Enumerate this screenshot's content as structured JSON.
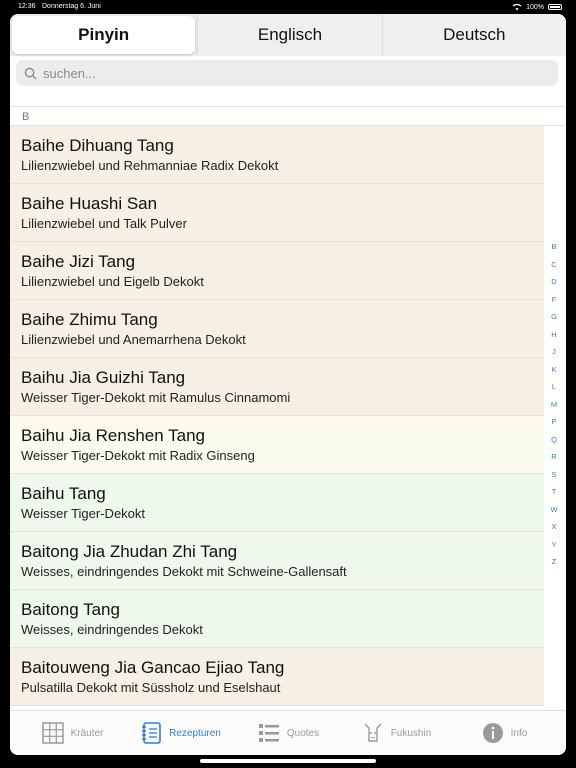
{
  "status": {
    "time": "12:36",
    "date": "Donnerstag 6. Juni",
    "battery": "100%"
  },
  "segments": [
    {
      "label": "Pinyin",
      "active": true
    },
    {
      "label": "Englisch",
      "active": false
    },
    {
      "label": "Deutsch",
      "active": false
    }
  ],
  "search": {
    "placeholder": "suchen..."
  },
  "section": "B",
  "rows": [
    {
      "title": "Baihe Dihuang Tang",
      "subtitle": "Lilienzwiebel und Rehmanniae Radix Dekokt",
      "tint": "beige"
    },
    {
      "title": "Baihe Huashi San",
      "subtitle": "Lilienzwiebel und Talk Pulver",
      "tint": "beige"
    },
    {
      "title": "Baihe Jizi Tang",
      "subtitle": "Lilienzwiebel und Eigelb Dekokt",
      "tint": "beige"
    },
    {
      "title": "Baihe Zhimu Tang",
      "subtitle": "Lilienzwiebel und Anemarrhena Dekokt",
      "tint": "beige"
    },
    {
      "title": "Baihu Jia Guizhi Tang",
      "subtitle": "Weisser Tiger-Dekokt mit Ramulus Cinnamomi",
      "tint": "beige"
    },
    {
      "title": "Baihu Jia Renshen Tang",
      "subtitle": "Weisser Tiger-Dekokt mit Radix Ginseng",
      "tint": "lightyellow"
    },
    {
      "title": "Baihu Tang",
      "subtitle": "Weisser Tiger-Dekokt",
      "tint": "lightgreen"
    },
    {
      "title": "Baitong Jia Zhudan Zhi Tang",
      "subtitle": "Weisses, eindringendes Dekokt mit Schweine-Gallensaft",
      "tint": "lightgreen"
    },
    {
      "title": "Baitong Tang",
      "subtitle": "Weisses, eindringendes Dekokt",
      "tint": "lightgreen"
    },
    {
      "title": "Baitouweng Jia Gancao Ejiao Tang",
      "subtitle": "Pulsatilla Dekokt mit Süssholz und Eselshaut",
      "tint": "beige"
    }
  ],
  "index_letters": [
    "B",
    "C",
    "D",
    "F",
    "G",
    "H",
    "J",
    "K",
    "L",
    "M",
    "P",
    "Q",
    "R",
    "S",
    "T",
    "W",
    "X",
    "Y",
    "Z"
  ],
  "tabs": [
    {
      "label": "Kräuter",
      "icon": "grid-icon",
      "active": false
    },
    {
      "label": "Rezepturen",
      "icon": "notebook-icon",
      "active": true
    },
    {
      "label": "Quotes",
      "icon": "list-icon",
      "active": false
    },
    {
      "label": "Fukushin",
      "icon": "body-icon",
      "active": false
    },
    {
      "label": "Info",
      "icon": "info-icon",
      "active": false
    }
  ],
  "colors": {
    "accent": "#2f7fdc",
    "beige": "#f5efe4",
    "lightyellow": "#fbfbee",
    "lightgreen": "#eff8ec"
  }
}
